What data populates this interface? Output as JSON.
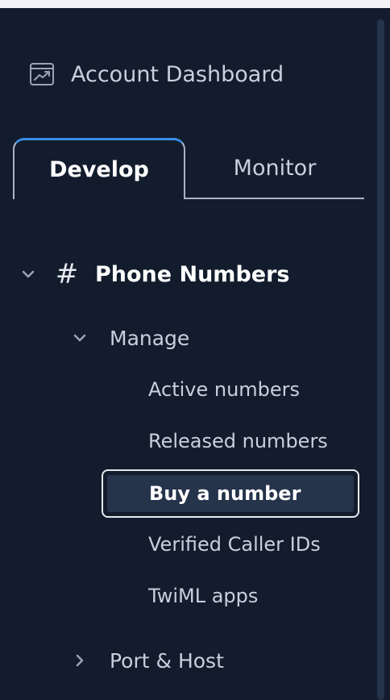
{
  "colors": {
    "background": "#121c2d",
    "tab_accent": "#3a8fe6",
    "selected_item_bg": "#25334b",
    "text": "#c9d0dc",
    "text_active": "#ffffff"
  },
  "dashboard_link": {
    "icon": "chart-dashboard-icon",
    "label": "Account Dashboard"
  },
  "tabs": [
    {
      "label": "Develop",
      "active": true
    },
    {
      "label": "Monitor",
      "active": false
    }
  ],
  "section": {
    "icon": "hash-icon",
    "glyph": "#",
    "title": "Phone Numbers",
    "expanded": true,
    "groups": [
      {
        "label": "Manage",
        "expanded": true,
        "items": [
          {
            "label": "Active numbers"
          },
          {
            "label": "Released numbers"
          },
          {
            "label": "Buy a number",
            "selected": true
          },
          {
            "label": "Verified Caller IDs"
          },
          {
            "label": "TwiML apps"
          }
        ]
      },
      {
        "label": "Port & Host",
        "expanded": false
      }
    ]
  }
}
